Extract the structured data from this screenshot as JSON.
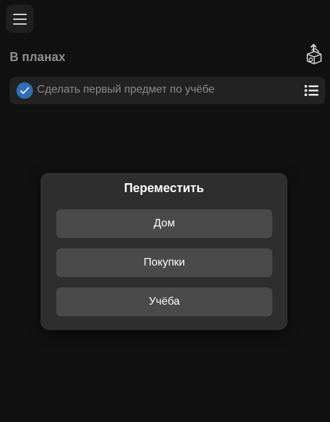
{
  "header": {
    "menu_icon": "hamburger-menu-icon"
  },
  "section": {
    "title": "В планах",
    "action_icon": "box-with-arrow-icon"
  },
  "tasks": [
    {
      "text": "Сделать первый предмет по учёбе",
      "checked": true,
      "check_icon": "checkmark-icon",
      "menu_icon": "list-icon"
    }
  ],
  "modal": {
    "title": "Переместить",
    "options": [
      {
        "label": "Дом"
      },
      {
        "label": "Покупки"
      },
      {
        "label": "Учёба"
      }
    ]
  },
  "colors": {
    "background": "#111111",
    "panel": "#222222",
    "modal": "#2e2e2e",
    "option_button": "#4a4a4a",
    "check_accent": "#2e6fb8"
  }
}
